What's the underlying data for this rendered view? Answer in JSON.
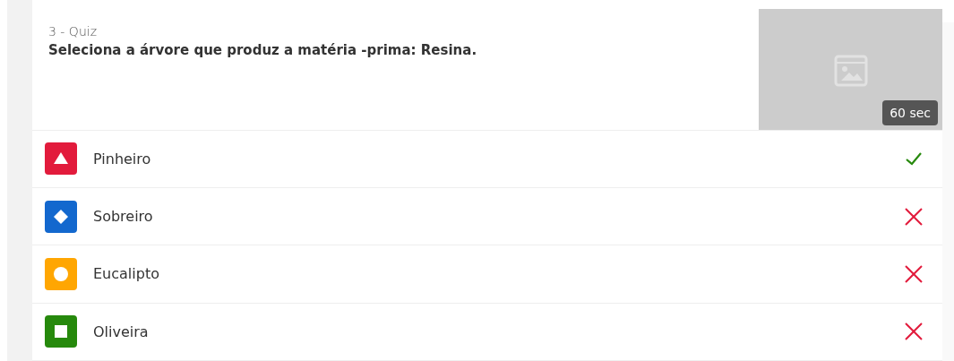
{
  "question": {
    "number": "3 - Quiz",
    "text": "Seleciona a árvore que produz a matéria -prima: Resina.",
    "media": {
      "kind": "placeholder",
      "time": "60 sec"
    }
  },
  "options": [
    {
      "kind": "triangle",
      "color": "#e21b3c",
      "text": "Pinheiro",
      "correct": true
    },
    {
      "kind": "diamond",
      "color": "#1368ce",
      "text": "Sobreiro",
      "correct": false
    },
    {
      "kind": "circle",
      "color": "#ffa602",
      "text": "Eucalipto",
      "correct": false
    },
    {
      "kind": "square",
      "color": "#26890c",
      "text": "Oliveira",
      "correct": false
    }
  ]
}
